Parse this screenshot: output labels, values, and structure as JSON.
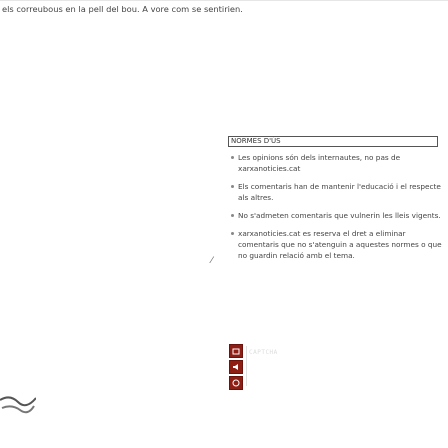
{
  "intro_text": "els correubous en la pell del bou. A vore com se sentirien.",
  "norms": {
    "title": "NORMES D'ÚS",
    "rules": [
      "Les opinions són dels internautes, no pas de xarxanoticies.cat",
      "Els comentaris han de mantenir l'educació i el respecte als altres.",
      "No s'admeten comentaris que vulnerin les lleis vigents.",
      "xarxanoticies.cat es reserva el dret a eliminar comentaris que no s'atenguin a aquestes normes o que no guardin relació amb el tema."
    ]
  },
  "captcha": {
    "placeholder_text": "CAPTCHA",
    "buttons": [
      "refresh-icon",
      "audio-icon",
      "help-icon"
    ]
  },
  "resize_glyph": "⁄",
  "colors": {
    "captcha_button": "#8e1d14",
    "text": "#444444",
    "border": "#555555"
  }
}
